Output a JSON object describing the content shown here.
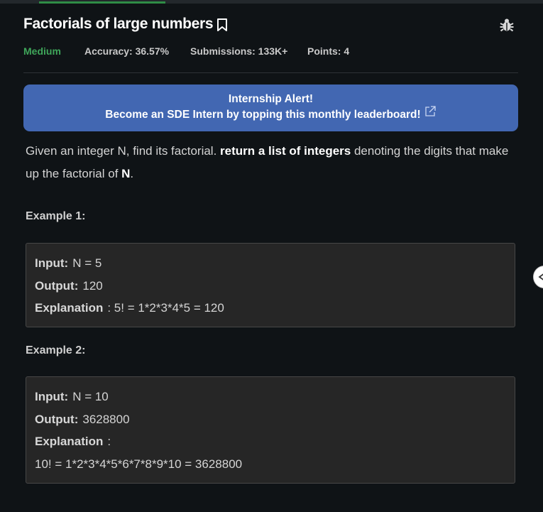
{
  "problem": {
    "title": "Factorials of large numbers",
    "difficulty": "Medium",
    "accuracy": "Accuracy: 36.57%",
    "submissions": "Submissions: 133K+",
    "points": "Points: 4"
  },
  "banner": {
    "line1": "Internship Alert!",
    "line2": "Become an SDE Intern by topping this monthly leaderboard!"
  },
  "statement": {
    "part1": "Given an integer N, find its factorial. ",
    "bold1": "return a list of integers",
    "part2": " denoting the digits that make up the factorial of ",
    "bold2": "N",
    "part3": "."
  },
  "examples": [
    {
      "heading": "Example 1:",
      "input_label": "Input:",
      "input_value": "N = 5",
      "output_label": "Output:",
      "output_value": "120",
      "explanation_label": "Explanation",
      "explanation_value": ": 5! = 1*2*3*4*5 = 120"
    },
    {
      "heading": "Example 2:",
      "input_label": "Input:",
      "input_value": "N = 10",
      "output_label": "Output:",
      "output_value": "3628800",
      "explanation_label": "Explanation",
      "explanation_colon": ":",
      "explanation_value": "10! = 1*2*3*4*5*6*7*8*9*10 = 3628800"
    }
  ],
  "icons": {
    "bookmark": "bookmark-icon",
    "bug": "bug-icon",
    "external_link": "external-link-icon",
    "side_toggle": "chevron-left-icon"
  },
  "colors": {
    "accent_green": "#2f8d46",
    "difficulty_medium": "#3fa65a",
    "banner_blue": "#4267b2"
  }
}
